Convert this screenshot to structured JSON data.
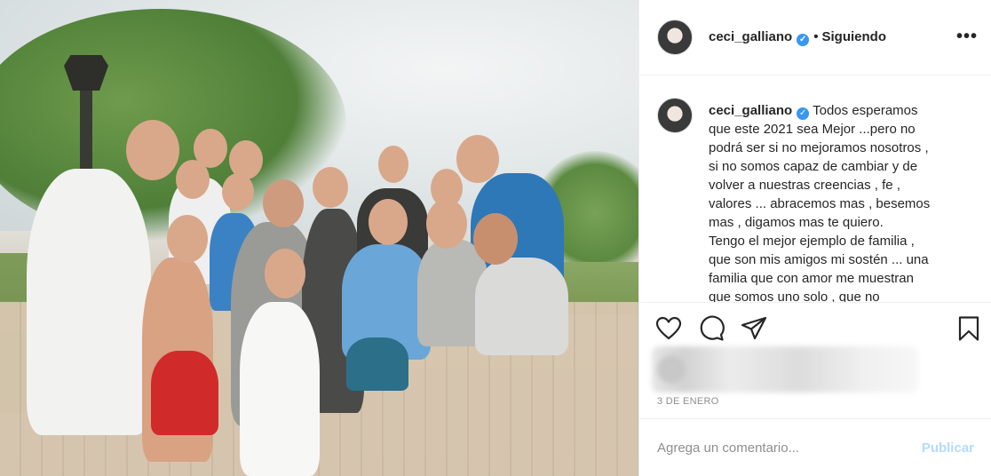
{
  "post": {
    "username": "ceci_galliano",
    "verified_badge": "✓",
    "separator": "•",
    "follow_status": "Siguiendo",
    "more_icon": "•••",
    "caption_lines": [
      "Todos esperamos",
      "que este 2021 sea Mejor ...pero no",
      "podrá ser si no mejoramos nosotros ,",
      "si no somos capaz de cambiar y de",
      "volver a nuestras creencias , fe ,",
      "valores ... abracemos mas , besemos",
      "mas , digamos mas te quiero.",
      "Tengo el mejor ejemplo de familia ,",
      "que son mis amigos mi sostén ... una",
      "familia que con amor me muestran",
      "que somos uno solo , que no"
    ],
    "date": "3 DE ENERO",
    "comment_placeholder": "Agrega un comentario...",
    "publish_label": "Publicar",
    "icons": {
      "like": "heart-icon",
      "comment": "comment-icon",
      "share": "share-icon",
      "save": "bookmark-icon"
    }
  },
  "colors": {
    "link_blue": "#3897f0",
    "publish_disabled": "#b3dbff",
    "muted": "#8e8e8e",
    "border": "#efefef"
  }
}
